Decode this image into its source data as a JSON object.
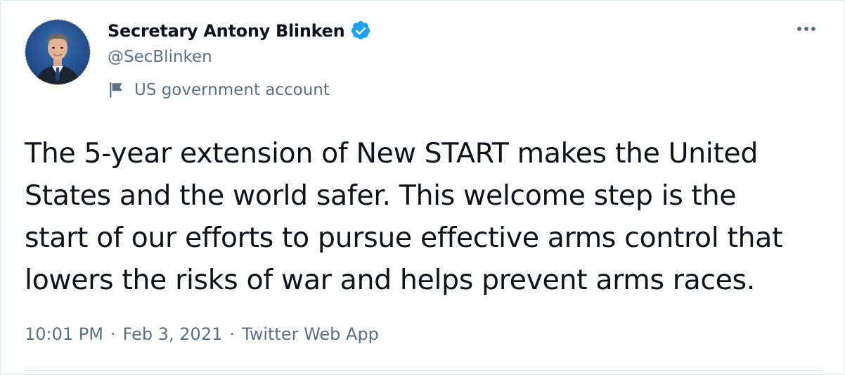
{
  "author": {
    "display_name": "Secretary Antony Blinken",
    "handle": "@SecBlinken",
    "verified": true,
    "label": "US government account"
  },
  "tweet": {
    "text": "The 5-year extension of New START makes the United\nStates and the world safer. This welcome step is the\nstart of our efforts to pursue effective arms control that\nlowers the risks of war and helps prevent arms races."
  },
  "meta": {
    "time": "10:01 PM",
    "date": "Feb 3, 2021",
    "source": "Twitter Web App",
    "separator": "·"
  },
  "icons": {
    "verified": "verified-badge-icon",
    "flag": "flag-icon",
    "more": "more-options-icon"
  },
  "colors": {
    "primary_text": "#0f1419",
    "secondary_text": "#5b7083",
    "verified_blue": "#1da1f2",
    "border": "#e1e8ed"
  }
}
